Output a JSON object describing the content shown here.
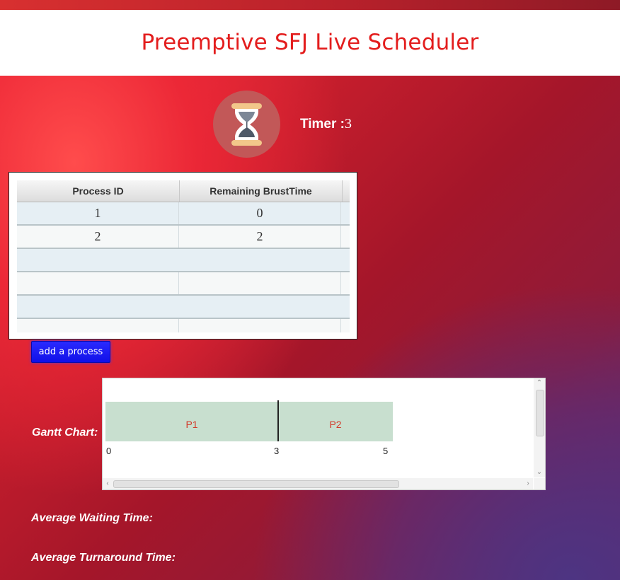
{
  "header": {
    "title": "Preemptive SFJ Live Scheduler"
  },
  "timer": {
    "icon": "hourglass-icon",
    "label": "Timer :",
    "value": "3"
  },
  "process_table": {
    "columns": [
      "Process ID",
      "Remaining BrustTime"
    ],
    "rows": [
      [
        "1",
        "0"
      ],
      [
        "2",
        "2"
      ]
    ]
  },
  "actions": {
    "add_process_label": "add a process"
  },
  "gantt": {
    "label": "Gantt Chart:",
    "segments": [
      {
        "name": "P1",
        "start": 0,
        "end": 3
      },
      {
        "name": "P2",
        "start": 3,
        "end": 5
      }
    ],
    "ticks": [
      "0",
      "3",
      "5"
    ]
  },
  "stats": {
    "avg_waiting_label": "Average Waiting Time:",
    "avg_turnaround_label": "Average Turnaround Time:"
  },
  "colors": {
    "title": "#e31d1d",
    "button": "#1a1aff",
    "gantt_bar": "#c8dfcf",
    "gantt_text": "#d23b2b"
  }
}
